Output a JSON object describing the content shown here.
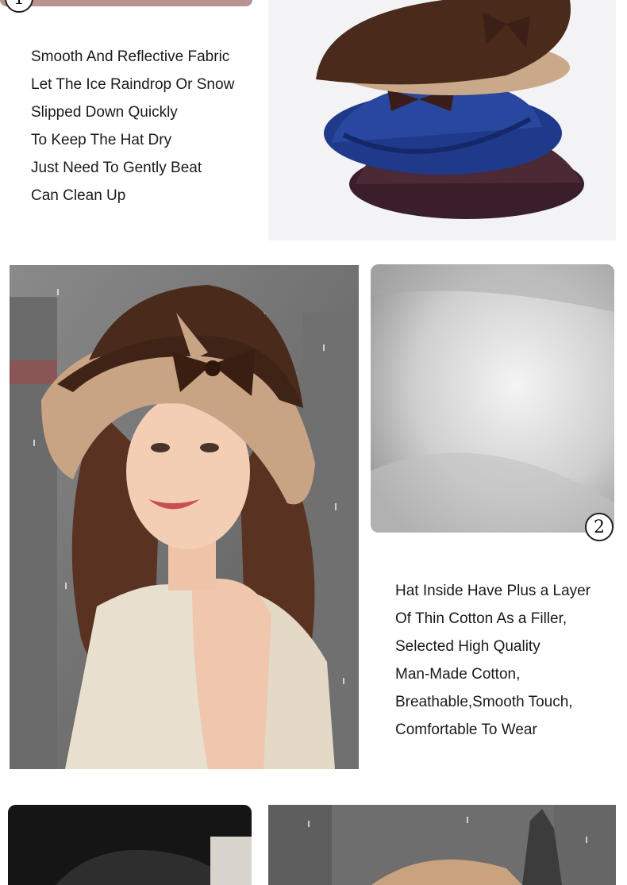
{
  "section1": {
    "badge": "1",
    "lines": [
      "Smooth And Reflective Fabric",
      "Let The Ice Raindrop Or Snow",
      "Slipped Down Quickly",
      "To Keep The Hat Dry",
      "Just Need To Gently Beat",
      "Can Clean Up"
    ]
  },
  "section2": {
    "badge": "2",
    "lines": [
      "Hat Inside Have Plus a Layer",
      "Of Thin Cotton As a Filler,",
      "Selected High Quality",
      "Man-Made Cotton,",
      "Breathable,Smooth Touch,",
      "Comfortable To Wear"
    ]
  },
  "colors": {
    "hat_brown": "#4a2a1a",
    "hat_tan": "#c9a98a",
    "hat_navy": "#1f3a8a",
    "hat_purple": "#3a1f2a",
    "background": "#ffffff"
  }
}
